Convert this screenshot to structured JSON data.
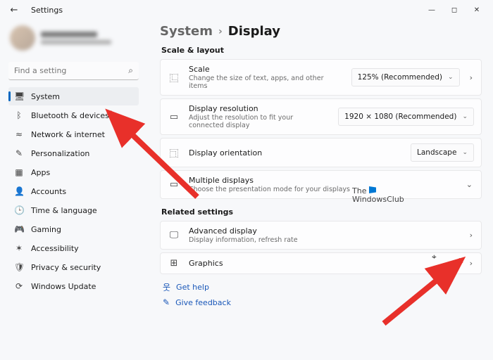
{
  "window": {
    "title": "Settings"
  },
  "user": {
    "name": "████████",
    "email": "████████████"
  },
  "search": {
    "placeholder": "Find a setting"
  },
  "sidebar": {
    "items": [
      {
        "label": "System",
        "icon": "🖥"
      },
      {
        "label": "Bluetooth & devices",
        "icon": "ᛒ"
      },
      {
        "label": "Network & internet",
        "icon": "≈"
      },
      {
        "label": "Personalization",
        "icon": "✎"
      },
      {
        "label": "Apps",
        "icon": "▦"
      },
      {
        "label": "Accounts",
        "icon": "👤"
      },
      {
        "label": "Time & language",
        "icon": "🕒"
      },
      {
        "label": "Gaming",
        "icon": "🎮"
      },
      {
        "label": "Accessibility",
        "icon": "✶"
      },
      {
        "label": "Privacy & security",
        "icon": "🛡"
      },
      {
        "label": "Windows Update",
        "icon": "⟳"
      }
    ],
    "selectedIndex": 0
  },
  "breadcrumb": {
    "root": "System",
    "page": "Display"
  },
  "sections": {
    "scaleLayout": {
      "heading": "Scale & layout",
      "scale": {
        "title": "Scale",
        "sub": "Change the size of text, apps, and other items",
        "value": "125% (Recommended)"
      },
      "resolution": {
        "title": "Display resolution",
        "sub": "Adjust the resolution to fit your connected display",
        "value": "1920 × 1080 (Recommended)"
      },
      "orientation": {
        "title": "Display orientation",
        "value": "Landscape"
      },
      "multiple": {
        "title": "Multiple displays",
        "sub": "Choose the presentation mode for your displays"
      }
    },
    "related": {
      "heading": "Related settings",
      "advanced": {
        "title": "Advanced display",
        "sub": "Display information, refresh rate"
      },
      "graphics": {
        "title": "Graphics"
      }
    }
  },
  "links": {
    "help": "Get help",
    "feedback": "Give feedback"
  },
  "watermark": {
    "line1": "The",
    "line2": "WindowsClub"
  }
}
